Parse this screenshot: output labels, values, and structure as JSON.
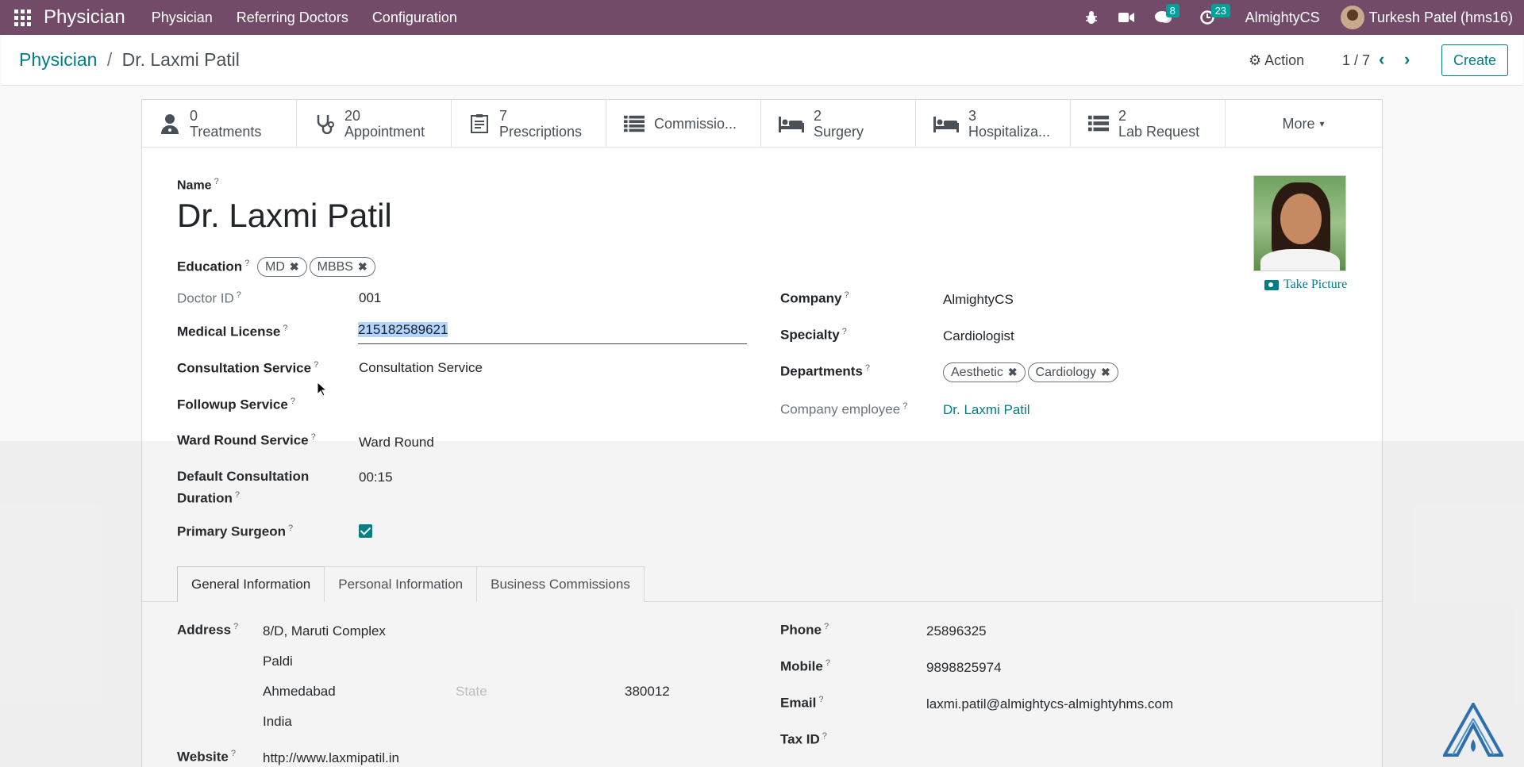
{
  "topbar": {
    "brand": "Physician",
    "menu": [
      "Physician",
      "Referring Doctors",
      "Configuration"
    ],
    "chat_count": "8",
    "activity_count": "23",
    "company": "AlmightyCS",
    "user": "Turkesh Patel (hms16)"
  },
  "control": {
    "breadcrumb_parent": "Physician",
    "breadcrumb_sep": "/",
    "breadcrumb_current": "Dr. Laxmi Patil",
    "action_label": "Action",
    "pager": "1 / 7",
    "create_label": "Create"
  },
  "smart_buttons": [
    {
      "count": "0",
      "label": "Treatments",
      "icon": "doctor-icon"
    },
    {
      "count": "20",
      "label": "Appointment",
      "icon": "stethoscope-icon"
    },
    {
      "count": "7",
      "label": "Prescriptions",
      "icon": "prescription-icon"
    },
    {
      "count": "",
      "label": "Commissio...",
      "icon": "list-icon"
    },
    {
      "count": "2",
      "label": "Surgery",
      "icon": "bed-icon"
    },
    {
      "count": "3",
      "label": "Hospitaliza...",
      "icon": "bed-icon"
    },
    {
      "count": "2",
      "label": "Lab Request",
      "icon": "list-icon"
    },
    {
      "label": "More"
    }
  ],
  "form": {
    "name_label": "Name",
    "name": "Dr. Laxmi Patil",
    "education_label": "Education",
    "education_tags": [
      "MD",
      "MBBS"
    ],
    "doctor_id_label": "Doctor ID",
    "doctor_id": "001",
    "medical_license_label": "Medical License",
    "medical_license": "215182589621",
    "consultation_service_label": "Consultation Service",
    "consultation_service": "Consultation Service",
    "followup_service_label": "Followup Service",
    "ward_round_label": "Ward Round Service",
    "ward_round": "Ward Round",
    "default_duration_label_1": "Default Consultation",
    "default_duration_label_2": "Duration",
    "default_duration": "00:15",
    "primary_surgeon_label": "Primary Surgeon",
    "primary_surgeon": true,
    "company_label": "Company",
    "company": "AlmightyCS",
    "specialty_label": "Specialty",
    "specialty": "Cardiologist",
    "departments_label": "Departments",
    "departments": [
      "Aesthetic",
      "Cardiology"
    ],
    "company_employee_label": "Company employee",
    "company_employee": "Dr. Laxmi Patil",
    "take_picture": "Take Picture"
  },
  "tabs": [
    "General Information",
    "Personal Information",
    "Business Commissions"
  ],
  "general": {
    "address_label": "Address",
    "street": "8/D, Maruti Complex",
    "street2": "Paldi",
    "city": "Ahmedabad",
    "state_placeholder": "State",
    "zip": "380012",
    "country": "India",
    "website_label": "Website",
    "website": "http://www.laxmipatil.in",
    "phone_label": "Phone",
    "phone": "25896325",
    "mobile_label": "Mobile",
    "mobile": "9898825974",
    "email_label": "Email",
    "email": "laxmi.patil@almightycs-almightyhms.com",
    "taxid_label": "Tax ID"
  },
  "colors": {
    "brand": "#714b67",
    "accent": "#017e84",
    "badge": "#00a09d"
  }
}
